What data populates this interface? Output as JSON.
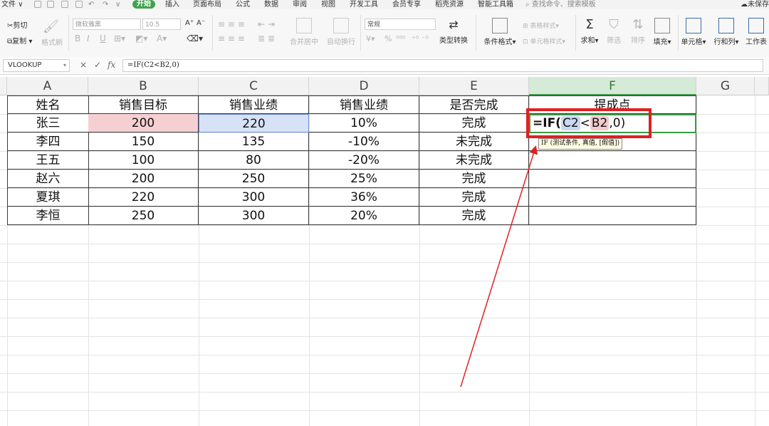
{
  "menubar": {
    "file": "文件",
    "tabs": [
      "开始",
      "插入",
      "页面布局",
      "公式",
      "数据",
      "审阅",
      "视图",
      "开发工具",
      "会员专享",
      "稻壳资源",
      "智能工具箱"
    ],
    "search_placeholder": "查找命令、搜索模板",
    "unsaved": "未保存"
  },
  "ribbon": {
    "cut": "剪切",
    "copy": "复制",
    "format_painter": "格式刷",
    "font_name": "微软雅黑",
    "font_size": "10.5",
    "merge_center": "合并居中",
    "wrap_text": "自动换行",
    "number_format": "常规",
    "type_convert": "类型转换",
    "conditional_format": "条件格式",
    "table_style": "表格样式",
    "cell_style": "单元格样式",
    "sum": "求和",
    "filter": "筛选",
    "sort": "排序",
    "fill": "填充",
    "cells": "单元格",
    "rows_cols": "行和列",
    "worksheet": "工作表",
    "currency_symbol": "¥",
    "percent_symbol": "%"
  },
  "formula_bar": {
    "name_box": "VLOOKUP",
    "cancel_icon": "×",
    "confirm_icon": "✓",
    "fx_label": "fx",
    "formula": "=IF(C2<B2,0)"
  },
  "columns": [
    "A",
    "B",
    "C",
    "D",
    "E",
    "F",
    "G"
  ],
  "table": {
    "headers": [
      "姓名",
      "销售目标",
      "销售业绩",
      "销售业绩",
      "是否完成",
      "提成点"
    ],
    "rows": [
      [
        "张三",
        "200",
        "220",
        "10%",
        "完成"
      ],
      [
        "李四",
        "150",
        "135",
        "-10%",
        "未完成"
      ],
      [
        "王五",
        "100",
        "80",
        "-20%",
        "未完成"
      ],
      [
        "赵六",
        "200",
        "250",
        "25%",
        "完成"
      ],
      [
        "夏琪",
        "220",
        "300",
        "36%",
        "完成"
      ],
      [
        "李恒",
        "250",
        "300",
        "20%",
        "完成"
      ]
    ]
  },
  "editing": {
    "prefix": "=IF(",
    "ref1": "C2",
    "op": "<",
    "ref2": "B2",
    "suffix": ",0)",
    "tooltip": "IF (测试条件, 真值, [假值])"
  },
  "colors": {
    "accent_green": "#3fa34d",
    "annotation_red": "#e02020",
    "ref_red_fill": "#f6cfd3",
    "ref_blue_fill": "#d7e2f7"
  }
}
